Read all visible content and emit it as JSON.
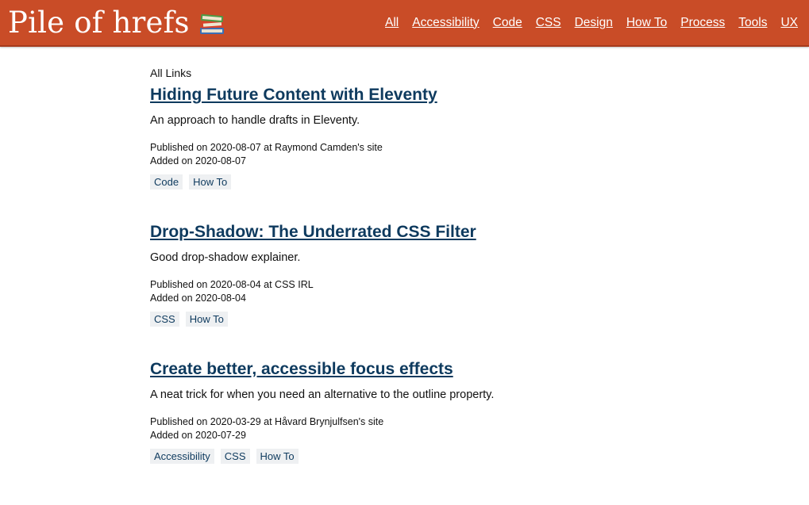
{
  "header": {
    "title": "Pile of hrefs",
    "nav": [
      "All",
      "Accessibility",
      "Code",
      "CSS",
      "Design",
      "How To",
      "Process",
      "Tools",
      "UX"
    ]
  },
  "main": {
    "section_label": "All Links",
    "entries": [
      {
        "title": "Hiding Future Content with Eleventy",
        "description": "An approach to handle drafts in Eleventy.",
        "published": "Published on 2020-08-07 at Raymond Camden's site",
        "added": "Added on 2020-08-07",
        "tags": [
          "Code",
          "How To"
        ]
      },
      {
        "title": "Drop-Shadow: The Underrated CSS Filter",
        "description": "Good drop-shadow explainer.",
        "published": "Published on 2020-08-04 at CSS IRL",
        "added": "Added on 2020-08-04",
        "tags": [
          "CSS",
          "How To"
        ]
      },
      {
        "title": "Create better, accessible focus effects",
        "description": "A neat trick for when you need an alternative to the outline property.",
        "published": "Published on 2020-03-29 at Håvard Brynjulfsen's site",
        "added": "Added on 2020-07-29",
        "tags": [
          "Accessibility",
          "CSS",
          "How To"
        ]
      }
    ]
  },
  "colors": {
    "header_bg": "#c94c27",
    "link": "#0e3a5e",
    "tag_bg": "#eef0f2"
  },
  "icons": {
    "brand": "books-icon"
  }
}
